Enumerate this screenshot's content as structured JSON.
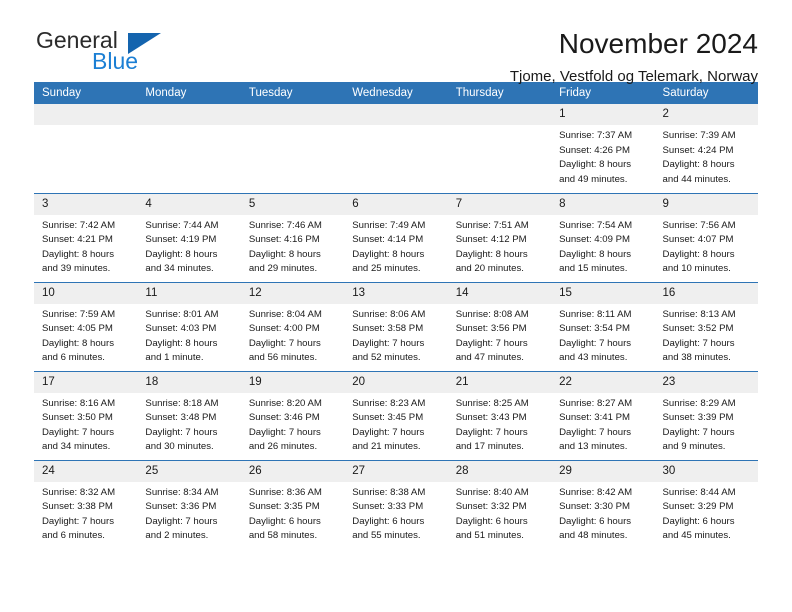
{
  "brand": {
    "general": "General",
    "blue": "Blue",
    "mark": "triangle-logo"
  },
  "header": {
    "title": "November 2024",
    "subtitle": "Tjome, Vestfold og Telemark, Norway"
  },
  "weekday_headers": [
    "Sunday",
    "Monday",
    "Tuesday",
    "Wednesday",
    "Thursday",
    "Friday",
    "Saturday"
  ],
  "colors": {
    "header_blue": "#2e74b5",
    "daynum_band": "#efefef",
    "brand_blue": "#1b7fd4",
    "brand_mark": "#1464ae",
    "text": "#1a1a1a"
  },
  "weeks": [
    [
      {
        "day": "",
        "blank": true
      },
      {
        "day": "",
        "blank": true
      },
      {
        "day": "",
        "blank": true
      },
      {
        "day": "",
        "blank": true
      },
      {
        "day": "",
        "blank": true
      },
      {
        "day": "1",
        "sunrise": "Sunrise: 7:37 AM",
        "sunset": "Sunset: 4:26 PM",
        "daylight1": "Daylight: 8 hours",
        "daylight2": "and 49 minutes."
      },
      {
        "day": "2",
        "sunrise": "Sunrise: 7:39 AM",
        "sunset": "Sunset: 4:24 PM",
        "daylight1": "Daylight: 8 hours",
        "daylight2": "and 44 minutes."
      }
    ],
    [
      {
        "day": "3",
        "sunrise": "Sunrise: 7:42 AM",
        "sunset": "Sunset: 4:21 PM",
        "daylight1": "Daylight: 8 hours",
        "daylight2": "and 39 minutes."
      },
      {
        "day": "4",
        "sunrise": "Sunrise: 7:44 AM",
        "sunset": "Sunset: 4:19 PM",
        "daylight1": "Daylight: 8 hours",
        "daylight2": "and 34 minutes."
      },
      {
        "day": "5",
        "sunrise": "Sunrise: 7:46 AM",
        "sunset": "Sunset: 4:16 PM",
        "daylight1": "Daylight: 8 hours",
        "daylight2": "and 29 minutes."
      },
      {
        "day": "6",
        "sunrise": "Sunrise: 7:49 AM",
        "sunset": "Sunset: 4:14 PM",
        "daylight1": "Daylight: 8 hours",
        "daylight2": "and 25 minutes."
      },
      {
        "day": "7",
        "sunrise": "Sunrise: 7:51 AM",
        "sunset": "Sunset: 4:12 PM",
        "daylight1": "Daylight: 8 hours",
        "daylight2": "and 20 minutes."
      },
      {
        "day": "8",
        "sunrise": "Sunrise: 7:54 AM",
        "sunset": "Sunset: 4:09 PM",
        "daylight1": "Daylight: 8 hours",
        "daylight2": "and 15 minutes."
      },
      {
        "day": "9",
        "sunrise": "Sunrise: 7:56 AM",
        "sunset": "Sunset: 4:07 PM",
        "daylight1": "Daylight: 8 hours",
        "daylight2": "and 10 minutes."
      }
    ],
    [
      {
        "day": "10",
        "sunrise": "Sunrise: 7:59 AM",
        "sunset": "Sunset: 4:05 PM",
        "daylight1": "Daylight: 8 hours",
        "daylight2": "and 6 minutes."
      },
      {
        "day": "11",
        "sunrise": "Sunrise: 8:01 AM",
        "sunset": "Sunset: 4:03 PM",
        "daylight1": "Daylight: 8 hours",
        "daylight2": "and 1 minute."
      },
      {
        "day": "12",
        "sunrise": "Sunrise: 8:04 AM",
        "sunset": "Sunset: 4:00 PM",
        "daylight1": "Daylight: 7 hours",
        "daylight2": "and 56 minutes."
      },
      {
        "day": "13",
        "sunrise": "Sunrise: 8:06 AM",
        "sunset": "Sunset: 3:58 PM",
        "daylight1": "Daylight: 7 hours",
        "daylight2": "and 52 minutes."
      },
      {
        "day": "14",
        "sunrise": "Sunrise: 8:08 AM",
        "sunset": "Sunset: 3:56 PM",
        "daylight1": "Daylight: 7 hours",
        "daylight2": "and 47 minutes."
      },
      {
        "day": "15",
        "sunrise": "Sunrise: 8:11 AM",
        "sunset": "Sunset: 3:54 PM",
        "daylight1": "Daylight: 7 hours",
        "daylight2": "and 43 minutes."
      },
      {
        "day": "16",
        "sunrise": "Sunrise: 8:13 AM",
        "sunset": "Sunset: 3:52 PM",
        "daylight1": "Daylight: 7 hours",
        "daylight2": "and 38 minutes."
      }
    ],
    [
      {
        "day": "17",
        "sunrise": "Sunrise: 8:16 AM",
        "sunset": "Sunset: 3:50 PM",
        "daylight1": "Daylight: 7 hours",
        "daylight2": "and 34 minutes."
      },
      {
        "day": "18",
        "sunrise": "Sunrise: 8:18 AM",
        "sunset": "Sunset: 3:48 PM",
        "daylight1": "Daylight: 7 hours",
        "daylight2": "and 30 minutes."
      },
      {
        "day": "19",
        "sunrise": "Sunrise: 8:20 AM",
        "sunset": "Sunset: 3:46 PM",
        "daylight1": "Daylight: 7 hours",
        "daylight2": "and 26 minutes."
      },
      {
        "day": "20",
        "sunrise": "Sunrise: 8:23 AM",
        "sunset": "Sunset: 3:45 PM",
        "daylight1": "Daylight: 7 hours",
        "daylight2": "and 21 minutes."
      },
      {
        "day": "21",
        "sunrise": "Sunrise: 8:25 AM",
        "sunset": "Sunset: 3:43 PM",
        "daylight1": "Daylight: 7 hours",
        "daylight2": "and 17 minutes."
      },
      {
        "day": "22",
        "sunrise": "Sunrise: 8:27 AM",
        "sunset": "Sunset: 3:41 PM",
        "daylight1": "Daylight: 7 hours",
        "daylight2": "and 13 minutes."
      },
      {
        "day": "23",
        "sunrise": "Sunrise: 8:29 AM",
        "sunset": "Sunset: 3:39 PM",
        "daylight1": "Daylight: 7 hours",
        "daylight2": "and 9 minutes."
      }
    ],
    [
      {
        "day": "24",
        "sunrise": "Sunrise: 8:32 AM",
        "sunset": "Sunset: 3:38 PM",
        "daylight1": "Daylight: 7 hours",
        "daylight2": "and 6 minutes."
      },
      {
        "day": "25",
        "sunrise": "Sunrise: 8:34 AM",
        "sunset": "Sunset: 3:36 PM",
        "daylight1": "Daylight: 7 hours",
        "daylight2": "and 2 minutes."
      },
      {
        "day": "26",
        "sunrise": "Sunrise: 8:36 AM",
        "sunset": "Sunset: 3:35 PM",
        "daylight1": "Daylight: 6 hours",
        "daylight2": "and 58 minutes."
      },
      {
        "day": "27",
        "sunrise": "Sunrise: 8:38 AM",
        "sunset": "Sunset: 3:33 PM",
        "daylight1": "Daylight: 6 hours",
        "daylight2": "and 55 minutes."
      },
      {
        "day": "28",
        "sunrise": "Sunrise: 8:40 AM",
        "sunset": "Sunset: 3:32 PM",
        "daylight1": "Daylight: 6 hours",
        "daylight2": "and 51 minutes."
      },
      {
        "day": "29",
        "sunrise": "Sunrise: 8:42 AM",
        "sunset": "Sunset: 3:30 PM",
        "daylight1": "Daylight: 6 hours",
        "daylight2": "and 48 minutes."
      },
      {
        "day": "30",
        "sunrise": "Sunrise: 8:44 AM",
        "sunset": "Sunset: 3:29 PM",
        "daylight1": "Daylight: 6 hours",
        "daylight2": "and 45 minutes."
      }
    ]
  ]
}
